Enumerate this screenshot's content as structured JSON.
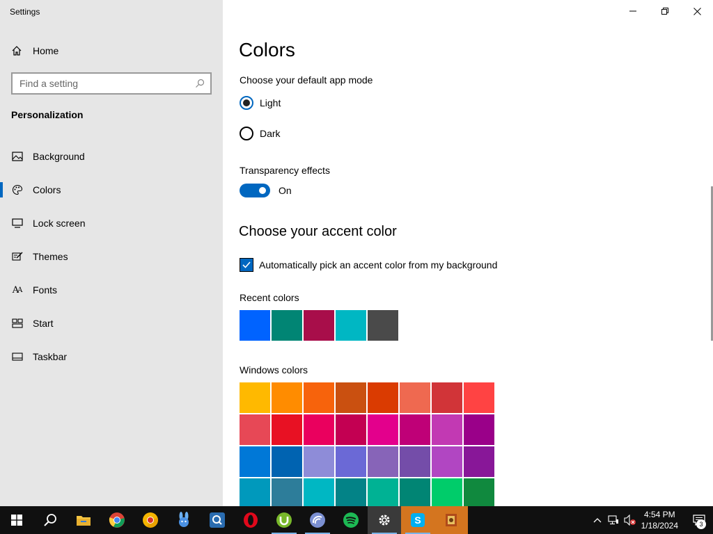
{
  "window": {
    "title": "Settings",
    "controls": {
      "minimize_icon": "minimize-icon",
      "restore_icon": "restore-icon",
      "close_icon": "close-icon"
    }
  },
  "sidebar": {
    "home_label": "Home",
    "search_placeholder": "Find a setting",
    "section_title": "Personalization",
    "items": [
      {
        "label": "Background",
        "icon": "picture-icon",
        "active": false
      },
      {
        "label": "Colors",
        "icon": "palette-icon",
        "active": true
      },
      {
        "label": "Lock screen",
        "icon": "monitor-icon",
        "active": false
      },
      {
        "label": "Themes",
        "icon": "themes-brush-icon",
        "active": false
      },
      {
        "label": "Fonts",
        "icon": "fonts-icon",
        "active": false
      },
      {
        "label": "Start",
        "icon": "start-grid-icon",
        "active": false
      },
      {
        "label": "Taskbar",
        "icon": "taskbar-icon",
        "active": false
      }
    ]
  },
  "main": {
    "page_title": "Colors",
    "app_mode_label": "Choose your default app mode",
    "app_mode_options": [
      {
        "label": "Light",
        "selected": true
      },
      {
        "label": "Dark",
        "selected": false
      }
    ],
    "transparency_label": "Transparency effects",
    "transparency_state": "On",
    "accent_heading": "Choose your accent color",
    "auto_accent_label": "Automatically pick an accent color from my background",
    "auto_accent_checked": true,
    "recent_colors_label": "Recent colors",
    "recent_colors": [
      "#0063ff",
      "#018574",
      "#a80e4a",
      "#00b7c3",
      "#4a4a4a"
    ],
    "windows_colors_label": "Windows colors",
    "windows_colors": [
      "#ffb900",
      "#ff8c00",
      "#f7630c",
      "#ca5010",
      "#da3b01",
      "#ef6950",
      "#d13438",
      "#ff4343",
      "#e74856",
      "#e81123",
      "#ea005e",
      "#c30052",
      "#e3008c",
      "#bf0077",
      "#c239b3",
      "#9a0089",
      "#0078d7",
      "#0063b1",
      "#8e8cd8",
      "#6b69d6",
      "#8764b8",
      "#744da9",
      "#b146c2",
      "#881798",
      "#0099bc",
      "#2d7d9a",
      "#00b7c3",
      "#038387",
      "#00b294",
      "#018574",
      "#00cc6a",
      "#10893e"
    ]
  },
  "taskbar": {
    "apps": [
      {
        "name": "start-button",
        "icon": "windows-logo-icon"
      },
      {
        "name": "search-button",
        "icon": "search-icon"
      },
      {
        "name": "file-explorer",
        "icon": "folder-icon"
      },
      {
        "name": "chrome",
        "icon": "chrome-icon"
      },
      {
        "name": "chrome-canary",
        "icon": "chrome-canary-icon"
      },
      {
        "name": "rabbit-app",
        "icon": "rabbit-icon"
      },
      {
        "name": "qbittorrent",
        "icon": "qbittorrent-icon"
      },
      {
        "name": "opera",
        "icon": "opera-icon"
      },
      {
        "name": "utorrent",
        "icon": "utorrent-icon"
      },
      {
        "name": "bittorrent",
        "icon": "bittorrent-icon"
      },
      {
        "name": "spotify",
        "icon": "spotify-icon"
      },
      {
        "name": "settings",
        "icon": "gear-icon"
      },
      {
        "name": "skype",
        "icon": "skype-icon"
      },
      {
        "name": "game-app",
        "icon": "game-icon"
      }
    ],
    "time": "4:54 PM",
    "date": "1/18/2024",
    "notification_count": "3"
  }
}
